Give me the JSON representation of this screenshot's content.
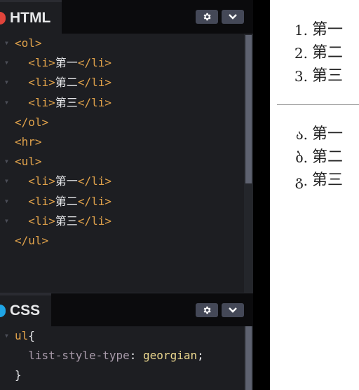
{
  "html_panel": {
    "title": "HTML",
    "dot_color": "#e0443b",
    "code_lines": [
      {
        "fold": true,
        "indent": "",
        "parts": [
          [
            "tag",
            "<ol>"
          ]
        ]
      },
      {
        "fold": true,
        "indent": "  ",
        "parts": [
          [
            "tag",
            "<li>"
          ],
          [
            "txt",
            "第一"
          ],
          [
            "tag",
            "</li>"
          ]
        ]
      },
      {
        "fold": true,
        "indent": "  ",
        "parts": [
          [
            "tag",
            "<li>"
          ],
          [
            "txt",
            "第二"
          ],
          [
            "tag",
            "</li>"
          ]
        ]
      },
      {
        "fold": true,
        "indent": "  ",
        "parts": [
          [
            "tag",
            "<li>"
          ],
          [
            "txt",
            "第三"
          ],
          [
            "tag",
            "</li>"
          ]
        ]
      },
      {
        "fold": false,
        "indent": "",
        "parts": [
          [
            "tag",
            "</ol>"
          ]
        ]
      },
      {
        "fold": false,
        "indent": "",
        "parts": [
          [
            "tag",
            "<hr>"
          ]
        ]
      },
      {
        "fold": true,
        "indent": "",
        "parts": [
          [
            "tag",
            "<ul>"
          ]
        ]
      },
      {
        "fold": true,
        "indent": "  ",
        "parts": [
          [
            "tag",
            "<li>"
          ],
          [
            "txt",
            "第一"
          ],
          [
            "tag",
            "</li>"
          ]
        ]
      },
      {
        "fold": true,
        "indent": "  ",
        "parts": [
          [
            "tag",
            "<li>"
          ],
          [
            "txt",
            "第二"
          ],
          [
            "tag",
            "</li>"
          ]
        ]
      },
      {
        "fold": true,
        "indent": "  ",
        "parts": [
          [
            "tag",
            "<li>"
          ],
          [
            "txt",
            "第三"
          ],
          [
            "tag",
            "</li>"
          ]
        ]
      },
      {
        "fold": false,
        "indent": "",
        "parts": [
          [
            "tag",
            "</ul>"
          ]
        ]
      }
    ]
  },
  "css_panel": {
    "title": "CSS",
    "dot_color": "#1fa5e6",
    "code_lines": [
      {
        "fold": true,
        "indent": "",
        "parts": [
          [
            "sel",
            "ul"
          ],
          [
            "txt",
            "{"
          ]
        ]
      },
      {
        "fold": false,
        "indent": "  ",
        "parts": [
          [
            "prop",
            "list-style-type"
          ],
          [
            "txt",
            ": "
          ],
          [
            "val",
            "georgian"
          ],
          [
            "txt",
            ";"
          ]
        ]
      },
      {
        "fold": false,
        "indent": "",
        "parts": [
          [
            "txt",
            "}"
          ]
        ]
      }
    ]
  },
  "header_buttons": {
    "settings_icon": "gear-icon",
    "collapse_icon": "chevron-down-icon"
  },
  "preview": {
    "ordered_list": {
      "markers": [
        "1.",
        "2.",
        "3."
      ],
      "items": [
        "第一",
        "第二",
        "第三"
      ]
    },
    "unordered_list": {
      "markers": [
        "ა.",
        "ბ.",
        "გ."
      ],
      "items": [
        "第一",
        "第二",
        "第三"
      ]
    }
  },
  "colors": {
    "editor_bg": "#1d1e22",
    "header_bg": "#0b0b0d",
    "tag": "#e0a24b",
    "property": "#a99bab",
    "value": "#ecd88f"
  }
}
